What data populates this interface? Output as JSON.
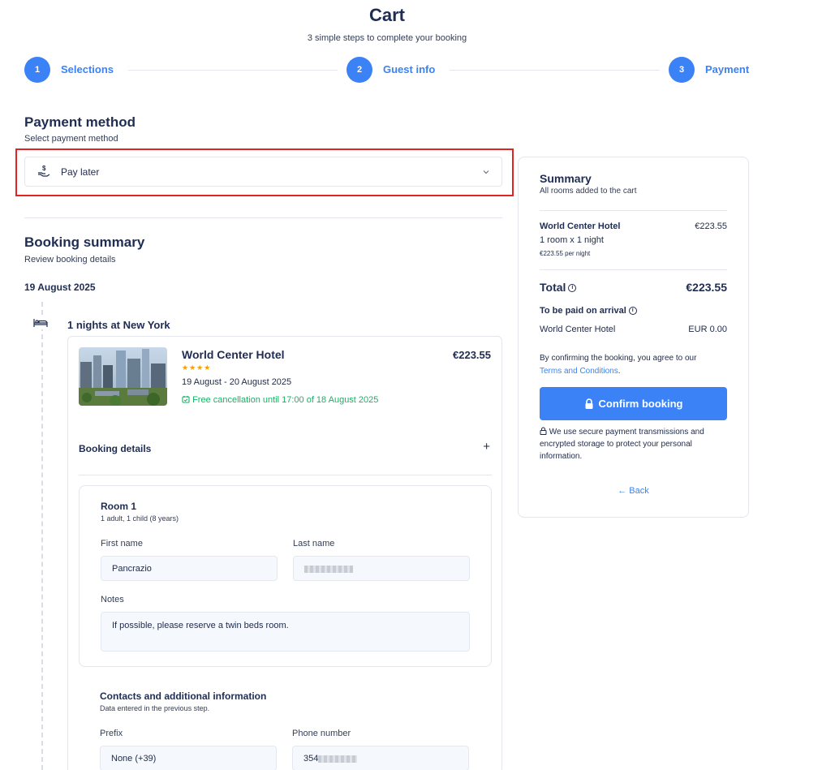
{
  "header": {
    "title": "Cart",
    "subtitle": "3 simple steps to complete your booking"
  },
  "steps": [
    {
      "number": "1",
      "label": "Selections"
    },
    {
      "number": "2",
      "label": "Guest info"
    },
    {
      "number": "3",
      "label": "Payment"
    }
  ],
  "payment": {
    "title": "Payment method",
    "subtitle": "Select payment method",
    "selected": "Pay later",
    "icon": "hand-dollar-icon"
  },
  "booking_summary": {
    "title": "Booking summary",
    "subtitle": "Review booking details",
    "date": "19 August 2025",
    "nights_label": "1 nights at New York",
    "hotel": {
      "name": "World Center Hotel",
      "price": "€223.55",
      "stars": 4,
      "stars_text": "★★★★",
      "dates": "19 August - 20 August 2025",
      "free_cancellation": "Free cancellation until 17:00 of 18 August 2025"
    },
    "booking_details_label": "Booking details",
    "room": {
      "title": "Room 1",
      "occupancy": "1 adult, 1 child (8 years)",
      "first_name_label": "First name",
      "first_name_value": "Pancrazio",
      "last_name_label": "Last name",
      "notes_label": "Notes",
      "notes_value": "If possible, please reserve a twin beds room."
    },
    "contacts": {
      "title": "Contacts and additional information",
      "subtitle": "Data entered in the previous step.",
      "prefix_label": "Prefix",
      "prefix_value": "None (+39)",
      "phone_label": "Phone number",
      "phone_value": "354"
    }
  },
  "summary": {
    "title": "Summary",
    "subtitle": "All rooms added to the cart",
    "hotel_name": "World Center Hotel",
    "hotel_price": "€223.55",
    "room_line": "1 room x 1 night",
    "per_night": "€223.55 per night",
    "total_label": "Total",
    "total_value": "€223.55",
    "pay_on_arrival_label": "To be paid on arrival",
    "arrival_hotel": "World Center Hotel",
    "arrival_amount": "EUR 0.00",
    "terms_text": "By confirming the booking, you agree to our",
    "terms_link": "Terms and Conditions",
    "terms_end": ".",
    "confirm_label": "Confirm booking",
    "secure_text": "We use secure payment transmissions and encrypted storage to protect your personal information.",
    "back_label": "← Back"
  },
  "colors": {
    "accent": "#3b82f6",
    "success": "#16b364",
    "highlight": "#e02424",
    "star": "#f59e0b",
    "text": "#1f2d52"
  }
}
